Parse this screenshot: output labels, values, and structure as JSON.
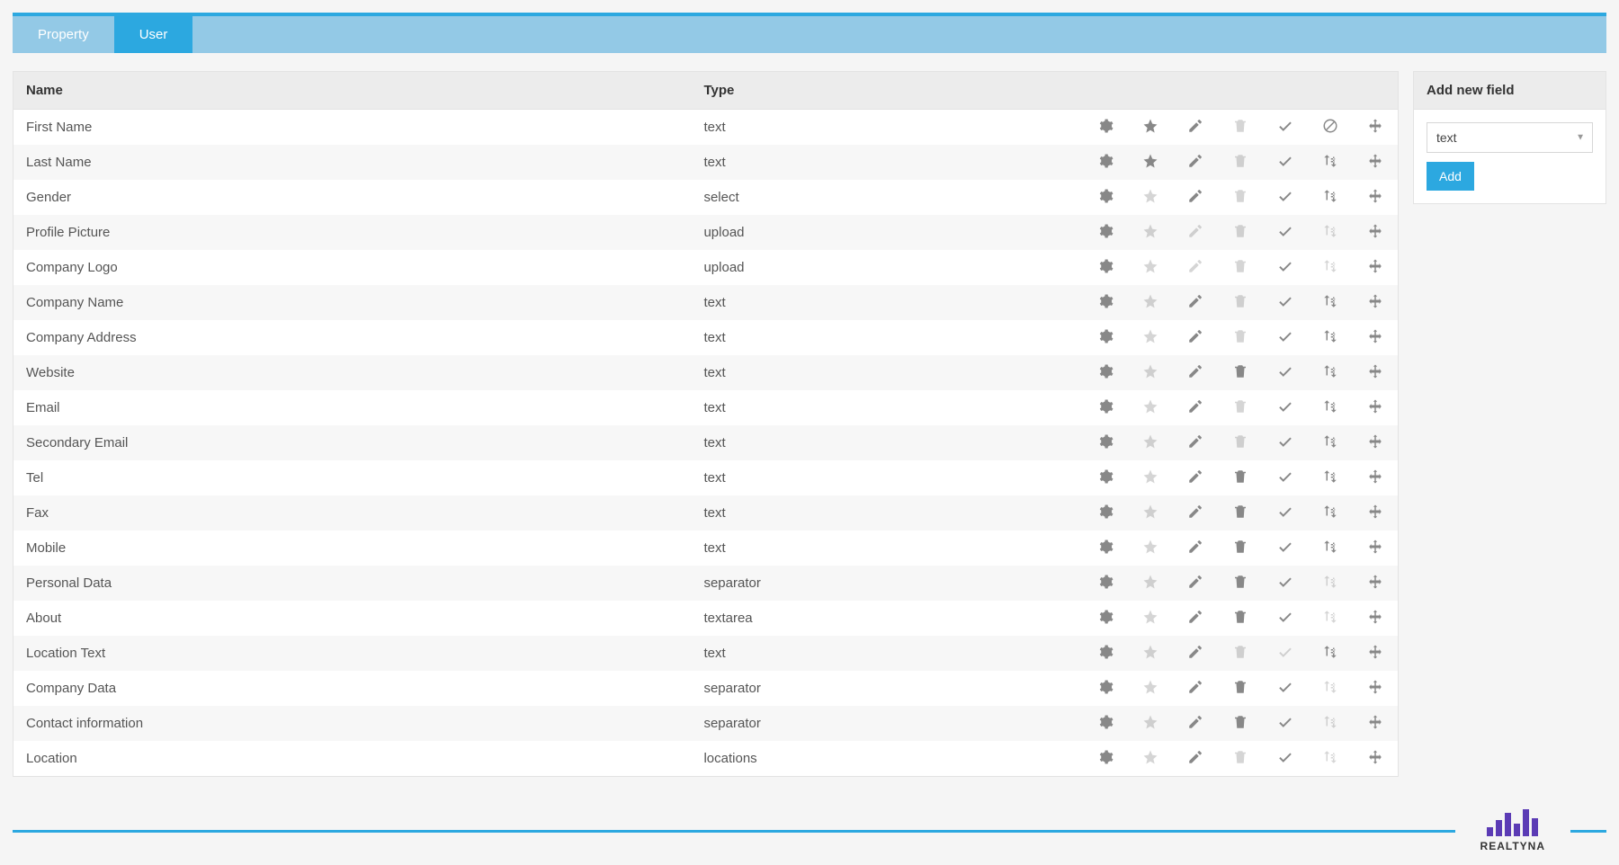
{
  "tabs": [
    {
      "label": "Property",
      "active": false
    },
    {
      "label": "User",
      "active": true
    }
  ],
  "columns": {
    "name": "Name",
    "type": "Type"
  },
  "rows": [
    {
      "name": "First Name",
      "type": "text",
      "gear": true,
      "star": "on",
      "edit": true,
      "trash": "off",
      "check": true,
      "extra": "ban",
      "move": true
    },
    {
      "name": "Last Name",
      "type": "text",
      "gear": true,
      "star": "on",
      "edit": true,
      "trash": "off",
      "check": true,
      "extra": "sort",
      "move": true
    },
    {
      "name": "Gender",
      "type": "select",
      "gear": true,
      "star": "off",
      "edit": true,
      "trash": "off",
      "check": true,
      "extra": "sort",
      "move": true
    },
    {
      "name": "Profile Picture",
      "type": "upload",
      "gear": true,
      "star": "off",
      "edit": false,
      "trash": "off",
      "check": true,
      "extra": "sort-off",
      "move": true
    },
    {
      "name": "Company Logo",
      "type": "upload",
      "gear": true,
      "star": "off",
      "edit": false,
      "trash": "off",
      "check": true,
      "extra": "sort-off",
      "move": true
    },
    {
      "name": "Company Name",
      "type": "text",
      "gear": true,
      "star": "off",
      "edit": true,
      "trash": "off",
      "check": true,
      "extra": "sort",
      "move": true
    },
    {
      "name": "Company Address",
      "type": "text",
      "gear": true,
      "star": "off",
      "edit": true,
      "trash": "off",
      "check": true,
      "extra": "sort",
      "move": true
    },
    {
      "name": "Website",
      "type": "text",
      "gear": true,
      "star": "off",
      "edit": true,
      "trash": "on",
      "check": true,
      "extra": "sort",
      "move": true
    },
    {
      "name": "Email",
      "type": "text",
      "gear": true,
      "star": "off",
      "edit": true,
      "trash": "off",
      "check": true,
      "extra": "sort",
      "move": true
    },
    {
      "name": "Secondary Email",
      "type": "text",
      "gear": true,
      "star": "off",
      "edit": true,
      "trash": "off",
      "check": true,
      "extra": "sort",
      "move": true
    },
    {
      "name": "Tel",
      "type": "text",
      "gear": true,
      "star": "off",
      "edit": true,
      "trash": "on",
      "check": true,
      "extra": "sort",
      "move": true
    },
    {
      "name": "Fax",
      "type": "text",
      "gear": true,
      "star": "off",
      "edit": true,
      "trash": "on",
      "check": true,
      "extra": "sort",
      "move": true
    },
    {
      "name": "Mobile",
      "type": "text",
      "gear": true,
      "star": "off",
      "edit": true,
      "trash": "on",
      "check": true,
      "extra": "sort",
      "move": true
    },
    {
      "name": "Personal Data",
      "type": "separator",
      "gear": true,
      "star": "off",
      "edit": true,
      "trash": "on",
      "check": true,
      "extra": "sort-off",
      "move": true
    },
    {
      "name": "About",
      "type": "textarea",
      "gear": true,
      "star": "off",
      "edit": true,
      "trash": "on",
      "check": true,
      "extra": "sort-off",
      "move": true
    },
    {
      "name": "Location Text",
      "type": "text",
      "gear": true,
      "star": "off",
      "edit": true,
      "trash": "off",
      "check": false,
      "extra": "sort",
      "move": true
    },
    {
      "name": "Company Data",
      "type": "separator",
      "gear": true,
      "star": "off",
      "edit": true,
      "trash": "on",
      "check": true,
      "extra": "sort-off",
      "move": true
    },
    {
      "name": "Contact information",
      "type": "separator",
      "gear": true,
      "star": "off",
      "edit": true,
      "trash": "on",
      "check": true,
      "extra": "sort-off",
      "move": true
    },
    {
      "name": "Location",
      "type": "locations",
      "gear": true,
      "star": "off",
      "edit": true,
      "trash": "off",
      "check": true,
      "extra": "sort-off",
      "move": true
    }
  ],
  "sidebar": {
    "title": "Add new field",
    "select_value": "text",
    "add_label": "Add"
  },
  "logo_text": "REALTYNA"
}
